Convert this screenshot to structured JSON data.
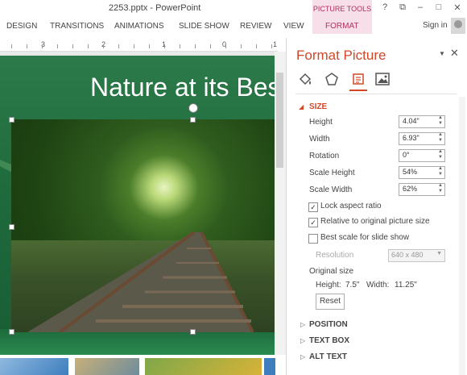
{
  "window": {
    "doc_title": "2253.pptx - PowerPoint",
    "picture_tools": "PICTURE TOOLS",
    "help": "?",
    "restore": "⧉",
    "minimize": "–",
    "maximize": "□",
    "close": "✕",
    "signin": "Sign in"
  },
  "ribbon": {
    "tabs": [
      "DESIGN",
      "TRANSITIONS",
      "ANIMATIONS",
      "SLIDE SHOW",
      "REVIEW",
      "VIEW",
      "FORMAT"
    ]
  },
  "ruler": {
    "numbers": [
      "3",
      "2",
      "1",
      "0",
      "1"
    ]
  },
  "slide": {
    "title": "Nature at its Best"
  },
  "pane": {
    "title": "Format Picture",
    "dropdown": "▼",
    "close": "✕",
    "icons": [
      "fill-line-icon",
      "effects-icon",
      "size-properties-icon",
      "picture-icon"
    ],
    "size": {
      "header": "SIZE",
      "arrow": "◢",
      "height_label": "Height",
      "height_value": "4.04\"",
      "width_label": "Width",
      "width_value": "6.93\"",
      "rotation_label": "Rotation",
      "rotation_value": "0°",
      "scale_height_label": "Scale Height",
      "scale_height_value": "54%",
      "scale_width_label": "Scale Width",
      "scale_width_value": "62%",
      "lock_aspect": "Lock aspect ratio",
      "relative_original": "Relative to original picture size",
      "best_scale": "Best scale for slide show",
      "resolution_label": "Resolution",
      "resolution_value": "640 x 480",
      "original_size_label": "Original size",
      "orig_height_label": "Height:",
      "orig_height_value": "7.5\"",
      "orig_width_label": "Width:",
      "orig_width_value": "11.25\"",
      "reset": "Reset"
    },
    "collapsed": {
      "arrow": "▷",
      "position": "POSITION",
      "text_box": "TEXT BOX",
      "alt_text": "ALT TEXT"
    },
    "checks": {
      "lock_aspect": true,
      "relative_original": true,
      "best_scale": false
    },
    "check_mark": "✓",
    "accent_color": "#d24726"
  }
}
